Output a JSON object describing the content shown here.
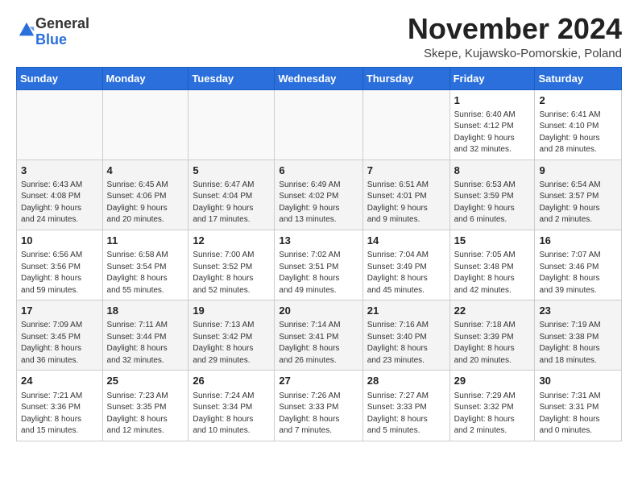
{
  "header": {
    "logo": {
      "general": "General",
      "blue": "Blue"
    },
    "title": "November 2024",
    "location": "Skepe, Kujawsko-Pomorskie, Poland"
  },
  "weekdays": [
    "Sunday",
    "Monday",
    "Tuesday",
    "Wednesday",
    "Thursday",
    "Friday",
    "Saturday"
  ],
  "weeks": [
    [
      {
        "day": "",
        "info": ""
      },
      {
        "day": "",
        "info": ""
      },
      {
        "day": "",
        "info": ""
      },
      {
        "day": "",
        "info": ""
      },
      {
        "day": "",
        "info": ""
      },
      {
        "day": "1",
        "info": "Sunrise: 6:40 AM\nSunset: 4:12 PM\nDaylight: 9 hours\nand 32 minutes."
      },
      {
        "day": "2",
        "info": "Sunrise: 6:41 AM\nSunset: 4:10 PM\nDaylight: 9 hours\nand 28 minutes."
      }
    ],
    [
      {
        "day": "3",
        "info": "Sunrise: 6:43 AM\nSunset: 4:08 PM\nDaylight: 9 hours\nand 24 minutes."
      },
      {
        "day": "4",
        "info": "Sunrise: 6:45 AM\nSunset: 4:06 PM\nDaylight: 9 hours\nand 20 minutes."
      },
      {
        "day": "5",
        "info": "Sunrise: 6:47 AM\nSunset: 4:04 PM\nDaylight: 9 hours\nand 17 minutes."
      },
      {
        "day": "6",
        "info": "Sunrise: 6:49 AM\nSunset: 4:02 PM\nDaylight: 9 hours\nand 13 minutes."
      },
      {
        "day": "7",
        "info": "Sunrise: 6:51 AM\nSunset: 4:01 PM\nDaylight: 9 hours\nand 9 minutes."
      },
      {
        "day": "8",
        "info": "Sunrise: 6:53 AM\nSunset: 3:59 PM\nDaylight: 9 hours\nand 6 minutes."
      },
      {
        "day": "9",
        "info": "Sunrise: 6:54 AM\nSunset: 3:57 PM\nDaylight: 9 hours\nand 2 minutes."
      }
    ],
    [
      {
        "day": "10",
        "info": "Sunrise: 6:56 AM\nSunset: 3:56 PM\nDaylight: 8 hours\nand 59 minutes."
      },
      {
        "day": "11",
        "info": "Sunrise: 6:58 AM\nSunset: 3:54 PM\nDaylight: 8 hours\nand 55 minutes."
      },
      {
        "day": "12",
        "info": "Sunrise: 7:00 AM\nSunset: 3:52 PM\nDaylight: 8 hours\nand 52 minutes."
      },
      {
        "day": "13",
        "info": "Sunrise: 7:02 AM\nSunset: 3:51 PM\nDaylight: 8 hours\nand 49 minutes."
      },
      {
        "day": "14",
        "info": "Sunrise: 7:04 AM\nSunset: 3:49 PM\nDaylight: 8 hours\nand 45 minutes."
      },
      {
        "day": "15",
        "info": "Sunrise: 7:05 AM\nSunset: 3:48 PM\nDaylight: 8 hours\nand 42 minutes."
      },
      {
        "day": "16",
        "info": "Sunrise: 7:07 AM\nSunset: 3:46 PM\nDaylight: 8 hours\nand 39 minutes."
      }
    ],
    [
      {
        "day": "17",
        "info": "Sunrise: 7:09 AM\nSunset: 3:45 PM\nDaylight: 8 hours\nand 36 minutes."
      },
      {
        "day": "18",
        "info": "Sunrise: 7:11 AM\nSunset: 3:44 PM\nDaylight: 8 hours\nand 32 minutes."
      },
      {
        "day": "19",
        "info": "Sunrise: 7:13 AM\nSunset: 3:42 PM\nDaylight: 8 hours\nand 29 minutes."
      },
      {
        "day": "20",
        "info": "Sunrise: 7:14 AM\nSunset: 3:41 PM\nDaylight: 8 hours\nand 26 minutes."
      },
      {
        "day": "21",
        "info": "Sunrise: 7:16 AM\nSunset: 3:40 PM\nDaylight: 8 hours\nand 23 minutes."
      },
      {
        "day": "22",
        "info": "Sunrise: 7:18 AM\nSunset: 3:39 PM\nDaylight: 8 hours\nand 20 minutes."
      },
      {
        "day": "23",
        "info": "Sunrise: 7:19 AM\nSunset: 3:38 PM\nDaylight: 8 hours\nand 18 minutes."
      }
    ],
    [
      {
        "day": "24",
        "info": "Sunrise: 7:21 AM\nSunset: 3:36 PM\nDaylight: 8 hours\nand 15 minutes."
      },
      {
        "day": "25",
        "info": "Sunrise: 7:23 AM\nSunset: 3:35 PM\nDaylight: 8 hours\nand 12 minutes."
      },
      {
        "day": "26",
        "info": "Sunrise: 7:24 AM\nSunset: 3:34 PM\nDaylight: 8 hours\nand 10 minutes."
      },
      {
        "day": "27",
        "info": "Sunrise: 7:26 AM\nSunset: 3:33 PM\nDaylight: 8 hours\nand 7 minutes."
      },
      {
        "day": "28",
        "info": "Sunrise: 7:27 AM\nSunset: 3:33 PM\nDaylight: 8 hours\nand 5 minutes."
      },
      {
        "day": "29",
        "info": "Sunrise: 7:29 AM\nSunset: 3:32 PM\nDaylight: 8 hours\nand 2 minutes."
      },
      {
        "day": "30",
        "info": "Sunrise: 7:31 AM\nSunset: 3:31 PM\nDaylight: 8 hours\nand 0 minutes."
      }
    ]
  ],
  "colors": {
    "header_bg": "#2a6fdb",
    "logo_blue": "#2a6fdb"
  }
}
